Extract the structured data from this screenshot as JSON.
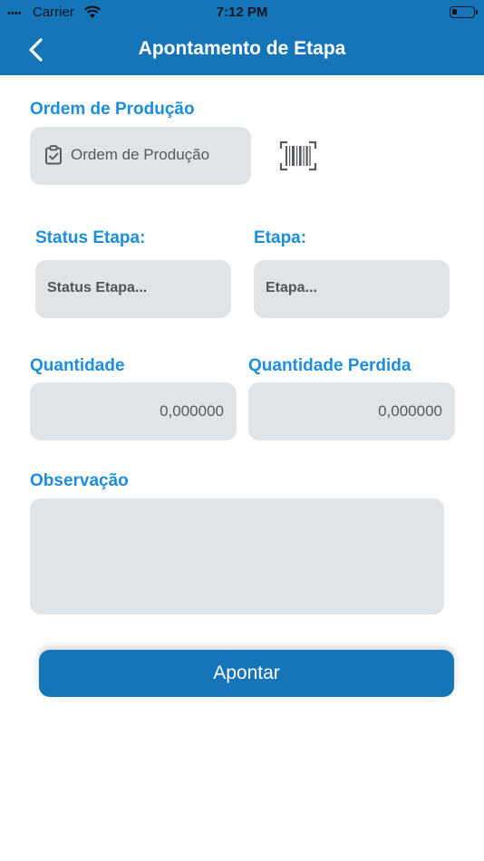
{
  "status_bar": {
    "signal": "••••",
    "carrier": "Carrier",
    "time": "7:12 PM"
  },
  "nav": {
    "title": "Apontamento de Etapa"
  },
  "ordem": {
    "label": "Ordem de Produção",
    "placeholder": "Ordem de Produção"
  },
  "status_etapa": {
    "label": "Status Etapa:",
    "placeholder": "Status Etapa..."
  },
  "etapa": {
    "label": "Etapa:",
    "placeholder": "Etapa..."
  },
  "quantidade": {
    "label": "Quantidade",
    "value": "0,000000"
  },
  "quantidade_perdida": {
    "label": "Quantidade Perdida",
    "value": "0,000000"
  },
  "observacao": {
    "label": "Observação",
    "value": ""
  },
  "submit": {
    "label": "Apontar"
  },
  "colors": {
    "primary": "#1675b9",
    "label": "#1c8edb",
    "field_bg": "#e0e4e7"
  }
}
